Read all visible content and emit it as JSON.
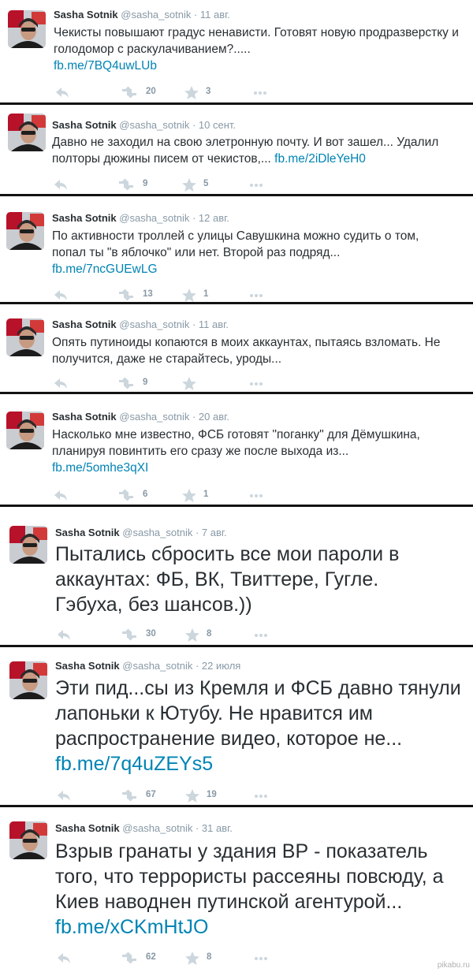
{
  "tweets": [
    {
      "name": "Sasha Sotnik",
      "handle": "@sasha_sotnik",
      "date": "11 авг.",
      "text": "Чекисты повышают градус ненависти. Готовят новую продразверстку и голодомор с раскулачиванием?.....",
      "link": "fb.me/7BQ4uwLUb",
      "retweets": "20",
      "favorites": "3",
      "size": "small"
    },
    {
      "name": "Sasha Sotnik",
      "handle": "@sasha_sotnik",
      "date": "10 сент.",
      "text": "Давно не заходил на свою элетронную почту. И вот зашел... Удалил полторы дюжины писем от чекистов,...",
      "link": "fb.me/2iDleYeH0",
      "retweets": "9",
      "favorites": "5",
      "size": "small"
    },
    {
      "name": "Sasha Sotnik",
      "handle": "@sasha_sotnik",
      "date": "12 авг.",
      "text": "По активности троллей с улицы Савушкина можно судить о том, попал ты \"в яблочко\" или нет. Второй раз подряд...",
      "link": "fb.me/7ncGUEwLG",
      "retweets": "13",
      "favorites": "1",
      "size": "small"
    },
    {
      "name": "Sasha Sotnik",
      "handle": "@sasha_sotnik",
      "date": "11 авг.",
      "text": "Опять путиноиды копаются в моих аккаунтах, пытаясь взломать. Не получится, даже не старайтесь, уроды...",
      "link": "",
      "retweets": "9",
      "favorites": "",
      "size": "small"
    },
    {
      "name": "Sasha Sotnik",
      "handle": "@sasha_sotnik",
      "date": "20 авг.",
      "text": "Насколько мне известно, ФСБ готовят \"поганку\" для Дёмушкина, планируя повинтить его сразу же после выхода из...",
      "link": "fb.me/5omhe3qXI",
      "retweets": "6",
      "favorites": "1",
      "size": "small"
    },
    {
      "name": "Sasha Sotnik",
      "handle": "@sasha_sotnik",
      "date": "7 авг.",
      "text": "Пытались сбросить все мои пароли в аккаунтах: ФБ, ВК, Твиттере, Гугле. Гэбуха, без шансов.))",
      "link": "",
      "retweets": "30",
      "favorites": "8",
      "size": "big"
    },
    {
      "name": "Sasha Sotnik",
      "handle": "@sasha_sotnik",
      "date": "22 июля",
      "text": "Эти пид...сы из Кремля и ФСБ давно тянули лапоньки к Ютубу. Не нравится им распространение видео, которое не...",
      "link": "fb.me/7q4uZEYs5",
      "retweets": "67",
      "favorites": "19",
      "size": "big"
    },
    {
      "name": "Sasha Sotnik",
      "handle": "@sasha_sotnik",
      "date": "31 авг.",
      "text": "Взрыв гранаты у здания ВР - показатель того, что террористы рассеяны повсюду, а Киев наводнен путинской агентурой...",
      "link": "fb.me/xCKmHtJO",
      "retweets": "62",
      "favorites": "8",
      "size": "big"
    }
  ],
  "watermark": "pikabu.ru",
  "colors": {
    "link": "#0084b4",
    "muted": "#8899a6",
    "text": "#292f33",
    "separator": "#121212"
  }
}
